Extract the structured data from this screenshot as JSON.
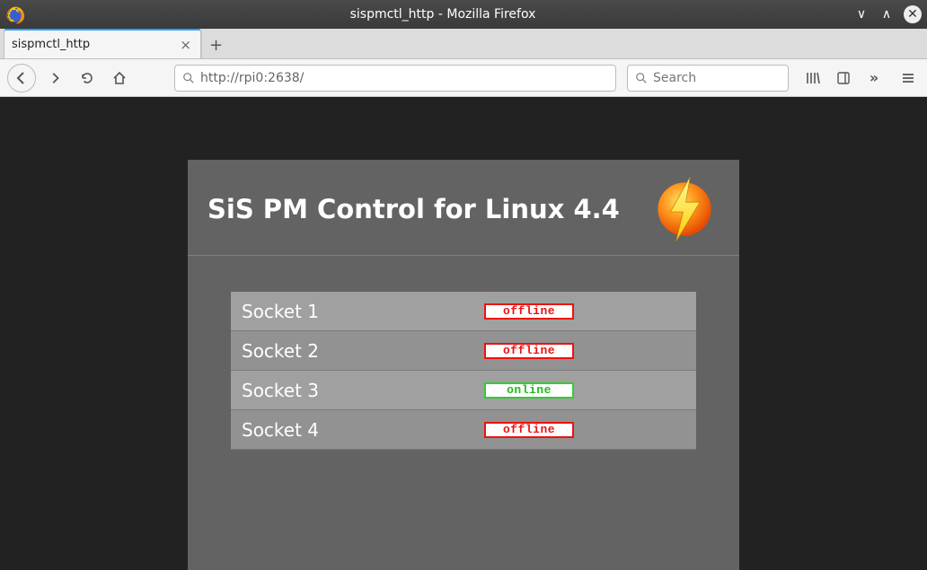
{
  "window": {
    "title": "sispmctl_http - Mozilla Firefox"
  },
  "tab": {
    "title": "sispmctl_http"
  },
  "toolbar": {
    "url": "http://rpi0:2638/",
    "search_placeholder": "Search"
  },
  "page": {
    "heading": "SiS PM Control for Linux 4.4",
    "sockets": [
      {
        "name": "Socket 1",
        "status": "offline"
      },
      {
        "name": "Socket 2",
        "status": "offline"
      },
      {
        "name": "Socket 3",
        "status": "online"
      },
      {
        "name": "Socket 4",
        "status": "offline"
      }
    ]
  },
  "icons": {
    "back": "←",
    "forward": "→",
    "reload": "⟳",
    "home": "⌂",
    "search": "🔍",
    "library": "|||\\",
    "reader": "▯",
    "more": "»",
    "menu": "≡",
    "min": "∨",
    "max": "∧",
    "close": "✕",
    "tab_close": "×",
    "new_tab": "+"
  }
}
